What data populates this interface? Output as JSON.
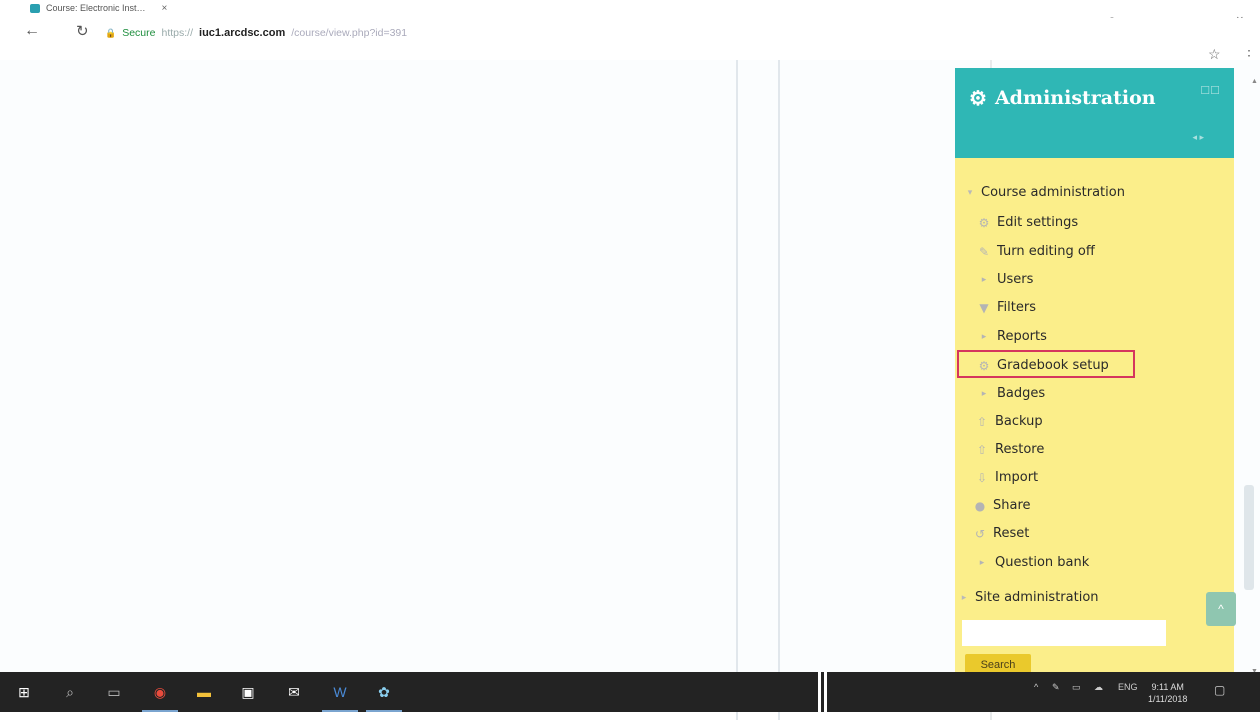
{
  "browser": {
    "tab_title": "Course: Electronic Inst…",
    "tab_close": "×",
    "secure_label": "Secure",
    "url_scheme": "https://",
    "url_host": "iuc1.arcdsc.com",
    "url_path": "/course/view.php?id=391",
    "back_icon": "arrow-left-icon",
    "reload_icon": "reload-icon"
  },
  "admin": {
    "title": "Administration",
    "accent_color": "#2fb7b5",
    "background_color": "#fbee8a",
    "course_admin_label": "Course administration",
    "items": [
      {
        "label": "Edit settings",
        "icon": "gear-icon"
      },
      {
        "label": "Turn editing off",
        "icon": "pencil-icon"
      },
      {
        "label": "Users",
        "icon": "expand-arrow-icon"
      },
      {
        "label": "Filters",
        "icon": "filter-icon"
      },
      {
        "label": "Reports",
        "icon": "expand-arrow-icon"
      },
      {
        "label": "Gradebook setup",
        "icon": "gear-icon"
      },
      {
        "label": "Badges",
        "icon": "expand-arrow-icon"
      },
      {
        "label": "Backup",
        "icon": "upload-icon"
      },
      {
        "label": "Restore",
        "icon": "upload-icon"
      },
      {
        "label": "Import",
        "icon": "download-icon"
      },
      {
        "label": "Share",
        "icon": "globe-icon"
      },
      {
        "label": "Reset",
        "icon": "reset-icon"
      },
      {
        "label": "Question bank",
        "icon": "expand-arrow-icon"
      }
    ],
    "site_admin_label": "Site administration",
    "search_value": "",
    "search_button": "Search",
    "highlight_color": "#d5355e"
  },
  "taskbar": {
    "language": "ENG",
    "time": "9:11 AM",
    "date": "1/11/2018"
  }
}
